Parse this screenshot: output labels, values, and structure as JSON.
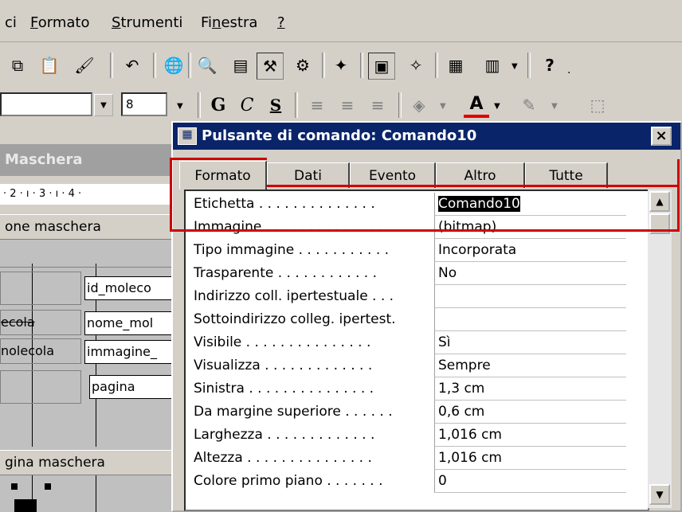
{
  "menubar": {
    "items": [
      "ci",
      "Formato",
      "Strumenti",
      "Finestra",
      "?"
    ]
  },
  "toolbar_format": {
    "font_size": "8",
    "bold": "G",
    "italic": "C",
    "underline": "S",
    "font_color_letter": "A"
  },
  "design": {
    "form_title": "Maschera",
    "ruler": "· 2 · ı · 3 · ı · 4 ·",
    "section_header": "one maschera",
    "section_footer": "gina maschera",
    "fields": [
      "id_moleco",
      "nome_mol",
      "immagine_",
      "pagina"
    ],
    "labels": [
      "",
      "ecola",
      "nolecola",
      ""
    ]
  },
  "dialog": {
    "title": "Pulsante di comando: Comando10",
    "close_label": "×",
    "tabs": [
      "Formato",
      "Dati",
      "Evento",
      "Altro",
      "Tutte"
    ],
    "active_tab": "Formato",
    "properties": [
      {
        "name": "Etichetta . . . . . . . . . . . . . .",
        "value": "Comando10"
      },
      {
        "name": "Immagine . . . . . . . . . . . . . .",
        "value": "(bitmap)"
      },
      {
        "name": "Tipo immagine . . . . . . . . . . .",
        "value": "Incorporata"
      },
      {
        "name": "Trasparente . . . . . . . . . . . .",
        "value": "No"
      },
      {
        "name": "Indirizzo coll. ipertestuale . . .",
        "value": ""
      },
      {
        "name": "Sottoindirizzo colleg. ipertest.",
        "value": ""
      },
      {
        "name": "Visibile . . . . . . . . . . . . . . .",
        "value": "Sì"
      },
      {
        "name": "Visualizza . . . . . . . . . . . . .",
        "value": "Sempre"
      },
      {
        "name": "Sinistra . . . . . . . . . . . . . . .",
        "value": "1,3 cm"
      },
      {
        "name": "Da margine superiore . . . . . .",
        "value": "0,6 cm"
      },
      {
        "name": "Larghezza . . . . . . . . . . . . .",
        "value": "1,016 cm"
      },
      {
        "name": "Altezza . . . . . . . . . . . . . . .",
        "value": "1,016 cm"
      },
      {
        "name": "Colore primo piano . . . . . . .",
        "value": "0"
      }
    ]
  },
  "colors": {
    "titlebar": "#0a246a",
    "highlight": "#d00000",
    "selection": "#000000"
  }
}
